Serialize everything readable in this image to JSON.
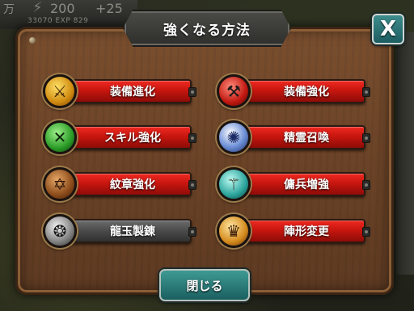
{
  "hud": {
    "left_text": "万",
    "stamina_icon": "lightning-bolt-icon",
    "stamina_value": "200",
    "stamina_bonus": "+25",
    "exp_text": "33070 EXP 829"
  },
  "dialog": {
    "title": "強くなる方法",
    "close_label": "X",
    "footer_button": "閉じる"
  },
  "menu": {
    "left": [
      {
        "label": "装備進化",
        "icon": "sword-evolve-icon",
        "style": "active"
      },
      {
        "label": "スキル強化",
        "icon": "crossed-swords-icon",
        "style": "active"
      },
      {
        "label": "紋章強化",
        "icon": "hexagram-crest-icon",
        "style": "active"
      },
      {
        "label": "龍玉製錬",
        "icon": "dragon-orb-icon",
        "style": "disabled"
      }
    ],
    "right": [
      {
        "label": "装備強化",
        "icon": "anvil-icon",
        "style": "active"
      },
      {
        "label": "精霊召喚",
        "icon": "spirit-wolf-icon",
        "style": "active"
      },
      {
        "label": "傭兵増強",
        "icon": "scroll-icon",
        "style": "active"
      },
      {
        "label": "陣形変更",
        "icon": "crown-formation-icon",
        "style": "active"
      }
    ]
  },
  "colors": {
    "panel_wood": "#6b4327",
    "button_red": "#c8160f",
    "button_teal": "#1b5f60",
    "button_gray": "#4a4a4a"
  }
}
